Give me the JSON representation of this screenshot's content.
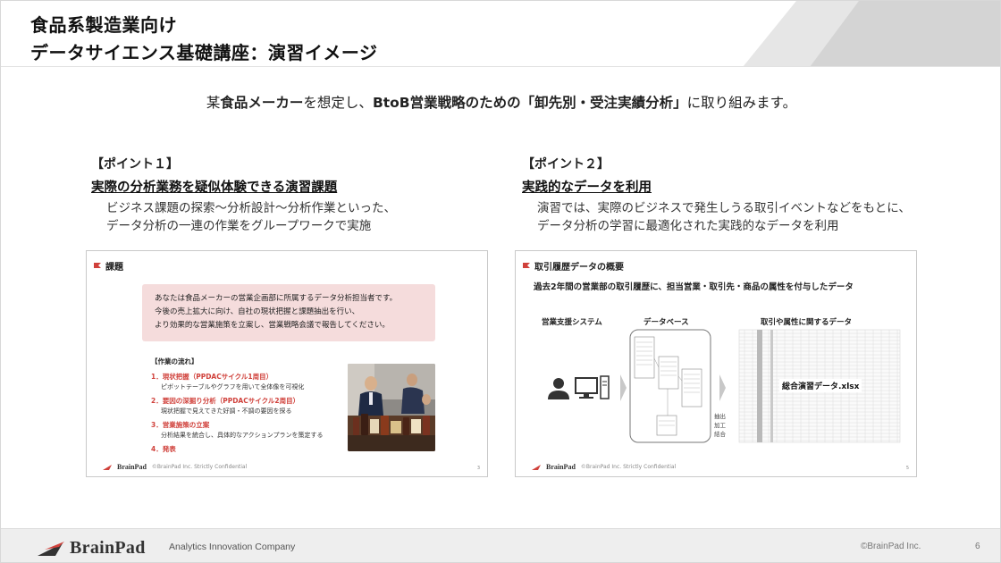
{
  "header": {
    "title_line1": "食品系製造業向け",
    "title_line2": "データサイエンス基礎講座：演習イメージ"
  },
  "lead": {
    "prefix": "某",
    "company": "食品メーカー",
    "middle": "を想定し、",
    "emphasis": "BtoB営業戦略のための「卸先別・受注実績分析」",
    "suffix": "に取り組みます。"
  },
  "points": [
    {
      "label": "【ポイント１】",
      "heading": "実際の分析業務を疑似体験できる演習課題",
      "body_line1": "ビジネス課題の探索～分析設計～分析作業といった、",
      "body_line2": "データ分析の一連の作業をグループワークで実施"
    },
    {
      "label": "【ポイント２】",
      "heading": "実践的なデータを利用",
      "body_line1": "演習では、実際のビジネスで発生しうる取引イベントなどをもとに、",
      "body_line2": "データ分析の学習に最適化された実践的なデータを利用"
    }
  ],
  "thumb1": {
    "title": "課題",
    "task_lines": [
      "あなたは食品メーカーの営業企画部に所属するデータ分析担当者です。",
      "今後の売上拡大に向け、自社の現状把握と課題抽出を行い、",
      "より効果的な営業施策を立案し、営業戦略会議で報告してください。"
    ],
    "flow_title": "【作業の流れ】",
    "flow": [
      {
        "head": "1．現状把握（PPDACサイクル1周目）",
        "desc": "ピボットテーブルやグラフを用いて全体像を可視化"
      },
      {
        "head": "2．要因の深掘り分析（PPDACサイクル2周目）",
        "desc": "現状把握で見えてきた好調・不調の要因を探る"
      },
      {
        "head": "3．営業施策の立案",
        "desc": "分析結果を統合し、具体的なアクションプランを策定する"
      },
      {
        "head": "4．発表",
        "desc": ""
      }
    ],
    "footer_logo": "BrainPad",
    "footer_text": "©BrainPad Inc.   Strictly Confidential",
    "page": "3"
  },
  "thumb2": {
    "title": "取引履歴データの概要",
    "subtitle": "過去2年間の営業部の取引履歴に、担当営業・取引先・商品の属性を付与したデータ",
    "col1": "営業支援システム",
    "col2": "データベース",
    "col3": "取引や属性に関するデータ",
    "file": "総合演習データ.xlsx",
    "proc1": "抽出",
    "proc2": "加工",
    "proc3": "結合",
    "footer_logo": "BrainPad",
    "footer_text": "©BrainPad Inc.   Strictly Confidential",
    "page": "5"
  },
  "footer": {
    "logo": "BrainPad",
    "tagline": "Analytics Innovation Company",
    "copyright": "©BrainPad Inc.",
    "page": "6"
  },
  "colors": {
    "accent_red": "#d0413b",
    "task_bg": "#f5dcdc",
    "header_gray": "#d9d9d9",
    "footer_bg": "#eeeeee"
  },
  "icons": [
    "person-icon",
    "computer-icon",
    "server-icon",
    "chevron-right-icon",
    "brainpad-logo-icon",
    "flag-icon"
  ]
}
